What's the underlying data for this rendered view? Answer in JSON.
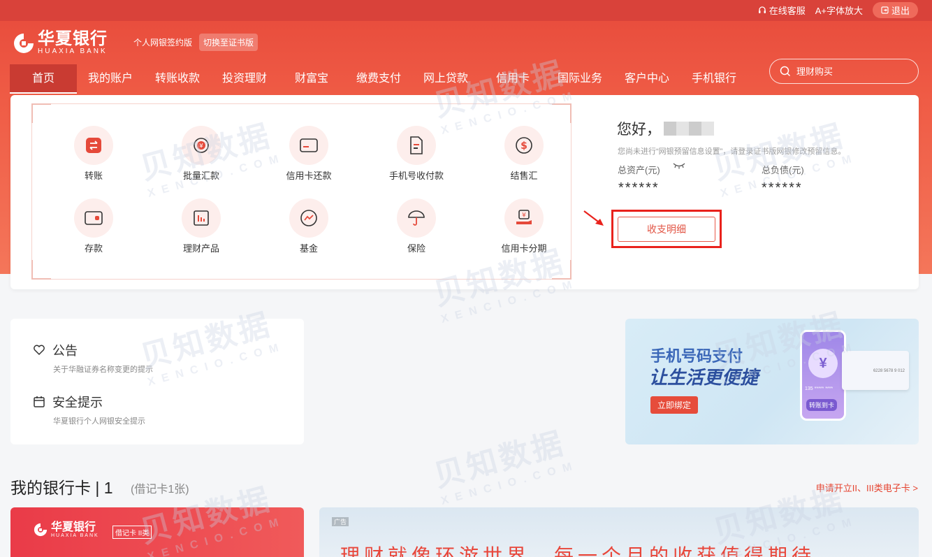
{
  "topbar": {
    "service": "在线客服",
    "font_size": "A+字体放大",
    "logout": "退出"
  },
  "brand": {
    "cn": "华夏银行",
    "en": "HUAXIA BANK",
    "version": "个人网银签约版",
    "switch": "切换至证书版",
    "color": "#e74a3b"
  },
  "nav": {
    "items": [
      "首页",
      "我的账户",
      "转账收款",
      "投资理财",
      "财富宝",
      "缴费支付",
      "网上贷款",
      "信用卡",
      "国际业务",
      "客户中心",
      "手机银行"
    ],
    "active": "首页"
  },
  "search": {
    "placeholder": "理财购买"
  },
  "functions": [
    {
      "label": "转账",
      "icon": "transfer-icon"
    },
    {
      "label": "批量汇款",
      "icon": "batch-remit-icon"
    },
    {
      "label": "信用卡还款",
      "icon": "credit-card-icon"
    },
    {
      "label": "手机号收付款",
      "icon": "phone-payment-icon"
    },
    {
      "label": "结售汇",
      "icon": "forex-icon"
    },
    {
      "label": "存款",
      "icon": "wallet-icon"
    },
    {
      "label": "理财产品",
      "icon": "chart-icon"
    },
    {
      "label": "基金",
      "icon": "fund-icon"
    },
    {
      "label": "保险",
      "icon": "umbrella-icon"
    },
    {
      "label": "信用卡分期",
      "icon": "installment-icon"
    }
  ],
  "account": {
    "greeting": "您好，",
    "notice": "您尚未进行“网银预留信息设置”，请登录证书版网银修改预留信息。",
    "asset_label": "总资产(元)",
    "asset_value": "******",
    "debt_label": "总负债(元)",
    "debt_value": "******",
    "detail_button": "收支明细"
  },
  "announcements": [
    {
      "title": "公告",
      "sub": "关于华融证券名称变更的提示",
      "icon": "heart-icon"
    },
    {
      "title": "安全提示",
      "sub": "华夏银行个人网银安全提示",
      "icon": "calendar-icon"
    }
  ],
  "banner": {
    "line1": "手机号码支付",
    "line2": "让生活更便捷",
    "button": "立即绑定",
    "phone_coin": "¥",
    "phone_number": "135 ***** ****",
    "phone_bind": "转账到卡",
    "card_number": "6228  5678 9  012"
  },
  "cards_section": {
    "title": "我的银行卡 | 1",
    "sub": "(借记卡1张)",
    "link": "申请开立II、III类电子卡 >",
    "card_brand": "华夏银行",
    "card_en": "HUAXIA BANK",
    "card_tag": "借记卡 II类"
  },
  "ad": {
    "tag": "广告",
    "text": "理财就像环游世界，每一个月的收获值得期待"
  },
  "watermark": {
    "big": "贝知数据",
    "small": "XENCIO.COM"
  }
}
